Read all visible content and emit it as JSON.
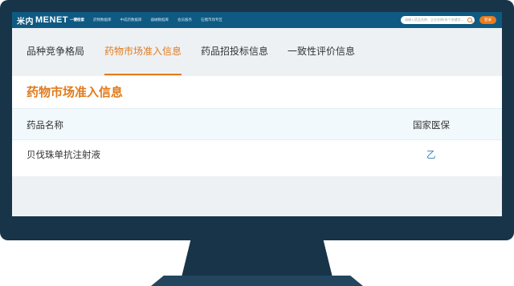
{
  "header": {
    "logo": "MENET",
    "nav": [
      "一键检索",
      "药物数据库",
      "中成药数据库",
      "器械数据库",
      "会员服务",
      "石榴市场专区"
    ],
    "search_placeholder": "请输入药品名称、企业名称(多个关键字...",
    "login_label": "登录"
  },
  "tabs": [
    {
      "label": "品种竞争格局",
      "active": false
    },
    {
      "label": "药物市场准入信息",
      "active": true
    },
    {
      "label": "药品招投标信息",
      "active": false
    },
    {
      "label": "一致性评价信息",
      "active": false
    }
  ],
  "section": {
    "title": "药物市场准入信息",
    "columns": [
      "药品名称",
      "国家医保"
    ],
    "rows": [
      {
        "name": "贝伐珠单抗注射液",
        "insurance": "乙"
      }
    ]
  },
  "colors": {
    "accent": "#e07b1d",
    "nav_bg": "#0f5a83",
    "monitor": "#183448",
    "link": "#2f7fb0"
  }
}
